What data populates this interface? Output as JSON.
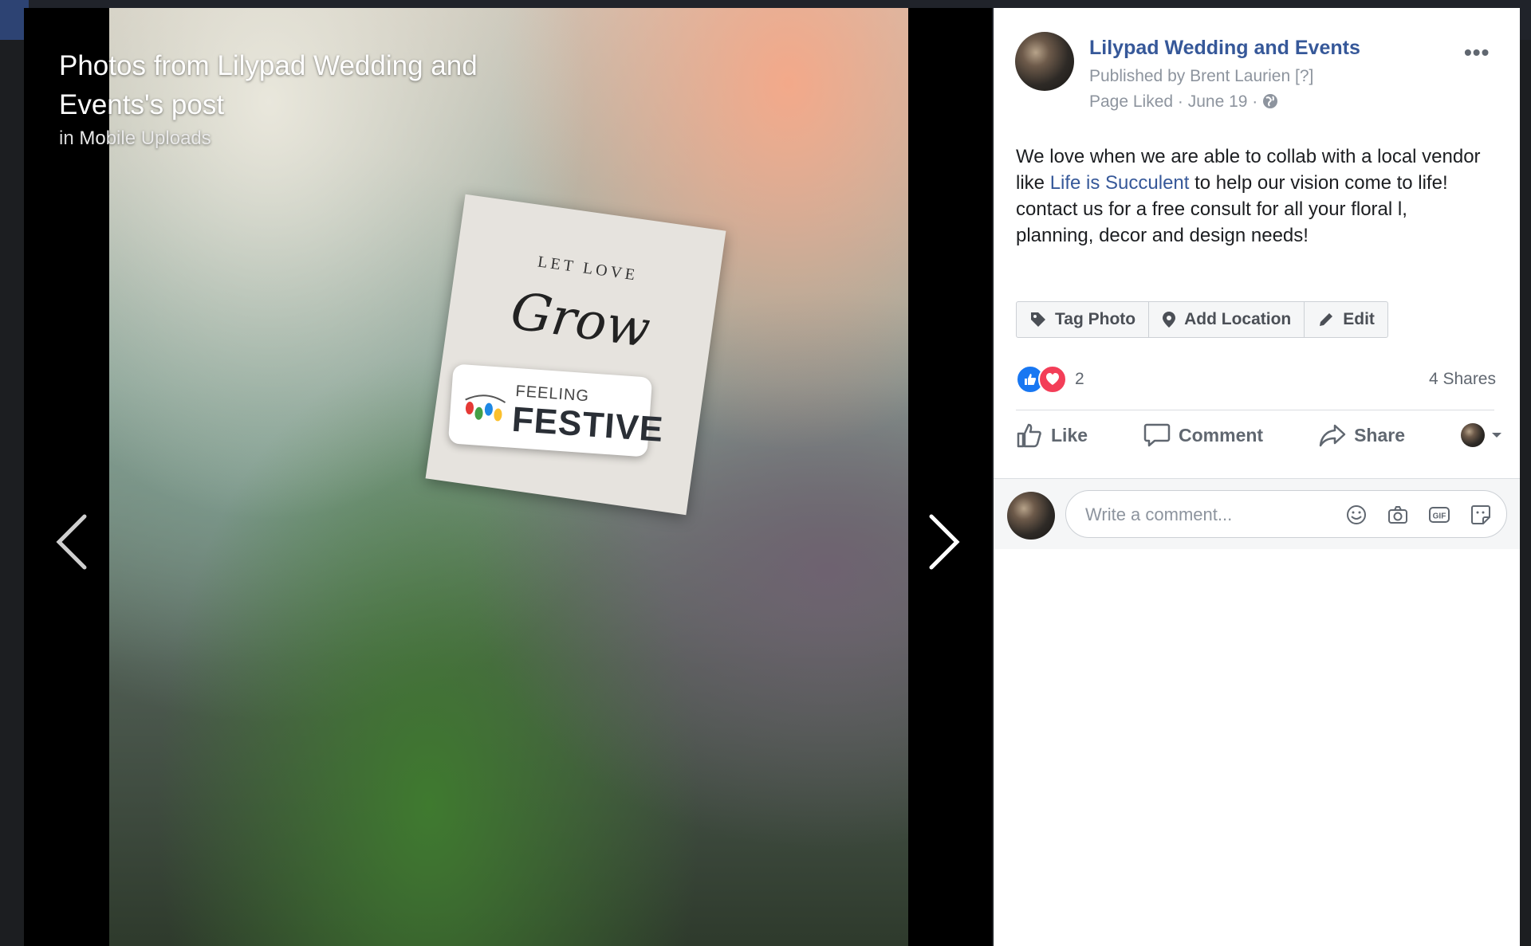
{
  "viewer": {
    "title_line1": "Photos from Lilypad Wedding and",
    "title_line2": "Events's post",
    "in_label": "in",
    "album": "Mobile Uploads",
    "photo_text": {
      "card_top": "LET LOVE",
      "card_script": "Grow",
      "sticker_small": "FEELING",
      "sticker_big": "FESTIVE"
    },
    "prev_icon": "chevron-left-icon",
    "next_icon": "chevron-right-icon"
  },
  "post": {
    "page_name": "Lilypad Wedding and Events",
    "published_by": "Published by Brent Laurien",
    "help_marker": "[?]",
    "meta": "Page Liked · June 19 ·",
    "more": "•••",
    "text_before": "We love when we are able to collab with a local vendor like ",
    "text_link": "Life is Succulent",
    "text_after": " to help our vision come to life! contact us for a free consult for all your floral l, planning, decor and design needs!"
  },
  "photo_actions": {
    "tag": "Tag Photo",
    "location": "Add Location",
    "edit": "Edit"
  },
  "stats": {
    "reactions_count": "2",
    "shares": "4 Shares"
  },
  "ufi": {
    "like": "Like",
    "comment": "Comment",
    "share": "Share"
  },
  "comment": {
    "placeholder": "Write a comment..."
  },
  "colors": {
    "link": "#365899",
    "like_blue": "#1877f2",
    "love_red": "#f33e58",
    "meta_gray": "#8d949e"
  }
}
